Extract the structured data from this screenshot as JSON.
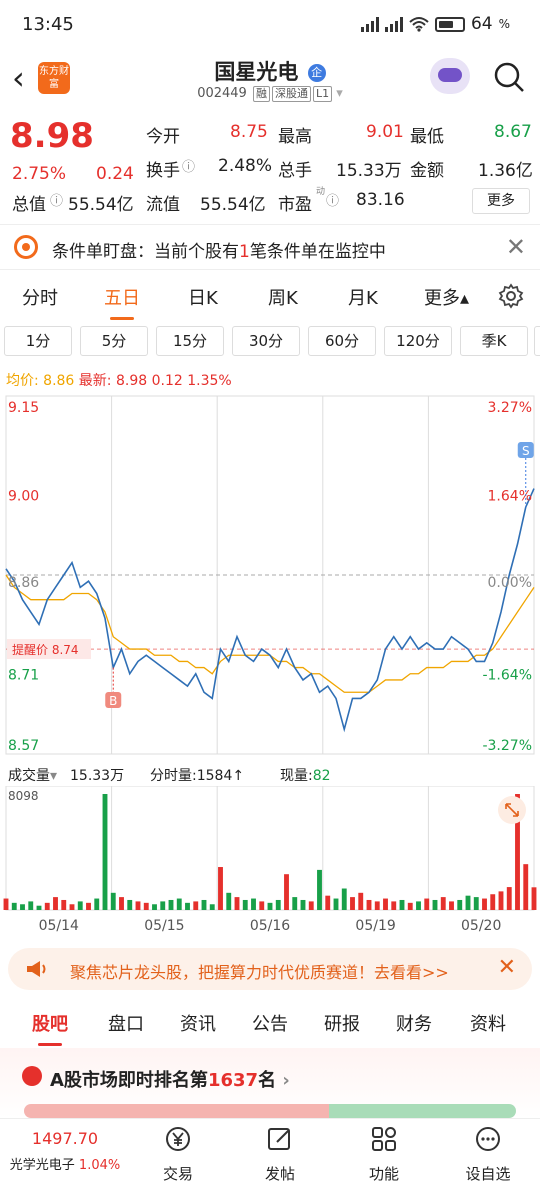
{
  "status": {
    "time": "13:45",
    "battery": "64"
  },
  "header": {
    "back": "‹",
    "logo": "东方财富",
    "stock_name": "国星光电",
    "name_badge": "企",
    "code": "002449",
    "tags": [
      "融",
      "深股通",
      "L1"
    ]
  },
  "quote": {
    "price": "8.98",
    "change_pct": "2.75%",
    "change": "0.24",
    "open_label": "今开",
    "open": "8.75",
    "high_label": "最高",
    "high": "9.01",
    "low_label": "最低",
    "low": "8.67",
    "turnover_label": "换手",
    "turnover": "2.48%",
    "volume_label": "总手",
    "volume": "15.33万",
    "amount_label": "金额",
    "amount": "1.36亿",
    "mcap_label": "总值",
    "mcap": "55.54亿",
    "float_label": "流值",
    "float": "55.54亿",
    "pe_label": "市盈",
    "pe_sup": "动",
    "pe": "83.16",
    "more": "更多"
  },
  "condition_bar": {
    "text_prefix": "条件单盯盘：当前个股有",
    "count": "1",
    "text_suffix": "笔条件单在监控中",
    "close": "✕"
  },
  "period_tabs": [
    "分时",
    "五日",
    "日K",
    "周K",
    "月K",
    "更多▴"
  ],
  "active_period": "五日",
  "intervals": [
    "1分",
    "5分",
    "15分",
    "30分",
    "60分",
    "120分",
    "季K"
  ],
  "chart_header": {
    "avg_label": "均价:",
    "avg": "8.86",
    "latest_label": "最新:",
    "latest": "8.98",
    "chg": "0.12",
    "chg_pct": "1.35%"
  },
  "volume_header": {
    "label": "成交量",
    "total": "15.33万",
    "time_vol_label": "分时量:",
    "time_vol": "1584",
    "time_vol_arrow": "↑",
    "now_label": "现量:",
    "now": "82",
    "max": "8098"
  },
  "alert": {
    "label": "提醒价",
    "price": "8.74"
  },
  "markers": {
    "buy": "B",
    "sell": "S"
  },
  "chart_data": {
    "type": "line",
    "x_ticks": [
      "05/14",
      "05/15",
      "05/16",
      "05/19",
      "05/20"
    ],
    "y_ticks": [
      "9.15",
      "9.00",
      "8.86",
      "8.71",
      "8.57"
    ],
    "y_pct_ticks": [
      "3.27%",
      "1.64%",
      "0.00%",
      "-1.64%",
      "-3.27%"
    ],
    "ylim": [
      8.57,
      9.15
    ],
    "prev_close": 8.86,
    "colors": {
      "price": "#2f6fb5",
      "avg": "#f0a500",
      "up": "#e5302c",
      "down": "#18a049"
    },
    "series": [
      {
        "name": "price",
        "values": [
          8.87,
          8.85,
          8.82,
          8.8,
          8.78,
          8.82,
          8.84,
          8.86,
          8.88,
          8.84,
          8.85,
          8.83,
          8.79,
          8.71,
          8.74,
          8.7,
          8.72,
          8.73,
          8.72,
          8.71,
          8.7,
          8.69,
          8.68,
          8.7,
          8.67,
          8.66,
          8.74,
          8.72,
          8.76,
          8.73,
          8.72,
          8.74,
          8.73,
          8.71,
          8.74,
          8.71,
          8.69,
          8.7,
          8.67,
          8.68,
          8.66,
          8.61,
          8.66,
          8.66,
          8.67,
          8.69,
          8.74,
          8.76,
          8.74,
          8.76,
          8.74,
          8.75,
          8.74,
          8.74,
          8.76,
          8.75,
          8.74,
          8.72,
          8.72,
          8.75,
          8.8,
          8.86,
          8.91,
          8.97,
          9.0
        ]
      },
      {
        "name": "avg",
        "values": [
          8.86,
          8.84,
          8.83,
          8.82,
          8.82,
          8.82,
          8.82,
          8.82,
          8.83,
          8.83,
          8.83,
          8.82,
          8.8,
          8.76,
          8.75,
          8.74,
          8.74,
          8.74,
          8.73,
          8.73,
          8.73,
          8.72,
          8.72,
          8.71,
          8.71,
          8.7,
          8.72,
          8.73,
          8.73,
          8.73,
          8.73,
          8.73,
          8.73,
          8.72,
          8.72,
          8.71,
          8.71,
          8.7,
          8.7,
          8.69,
          8.68,
          8.67,
          8.67,
          8.67,
          8.67,
          8.68,
          8.69,
          8.69,
          8.69,
          8.7,
          8.7,
          8.71,
          8.71,
          8.71,
          8.72,
          8.72,
          8.72,
          8.73,
          8.73,
          8.74,
          8.76,
          8.78,
          8.8,
          8.82,
          8.84
        ]
      },
      {
        "name": "volume",
        "values": [
          800,
          500,
          400,
          600,
          300,
          500,
          900,
          700,
          400,
          600,
          500,
          800,
          8098,
          1200,
          900,
          700,
          600,
          500,
          400,
          600,
          700,
          800,
          500,
          600,
          700,
          400,
          3000,
          1200,
          900,
          700,
          800,
          600,
          500,
          700,
          2500,
          900,
          700,
          600,
          2800,
          1000,
          800,
          1500,
          900,
          1200,
          700,
          600,
          800,
          600,
          700,
          500,
          600,
          800,
          700,
          900,
          600,
          700,
          1000,
          900,
          800,
          1100,
          1300,
          1600,
          8098,
          3200,
          1584
        ]
      }
    ]
  },
  "promo": {
    "text": "聚焦芯片龙头股，把握算力时代优质赛道！去看看>>",
    "close": "✕"
  },
  "content_tabs": [
    "股吧",
    "盘口",
    "资讯",
    "公告",
    "研报",
    "财务",
    "资料"
  ],
  "active_content_tab": "股吧",
  "rank": {
    "prefix": "A股市场即时排名第",
    "value": "1637",
    "suffix": "名",
    "arrow": "›"
  },
  "bottom_nav": {
    "index_value": "1497.70",
    "index_name": "光学光电子",
    "index_pct": "1.04%",
    "items": [
      "交易",
      "发帖",
      "功能",
      "设自选"
    ]
  }
}
